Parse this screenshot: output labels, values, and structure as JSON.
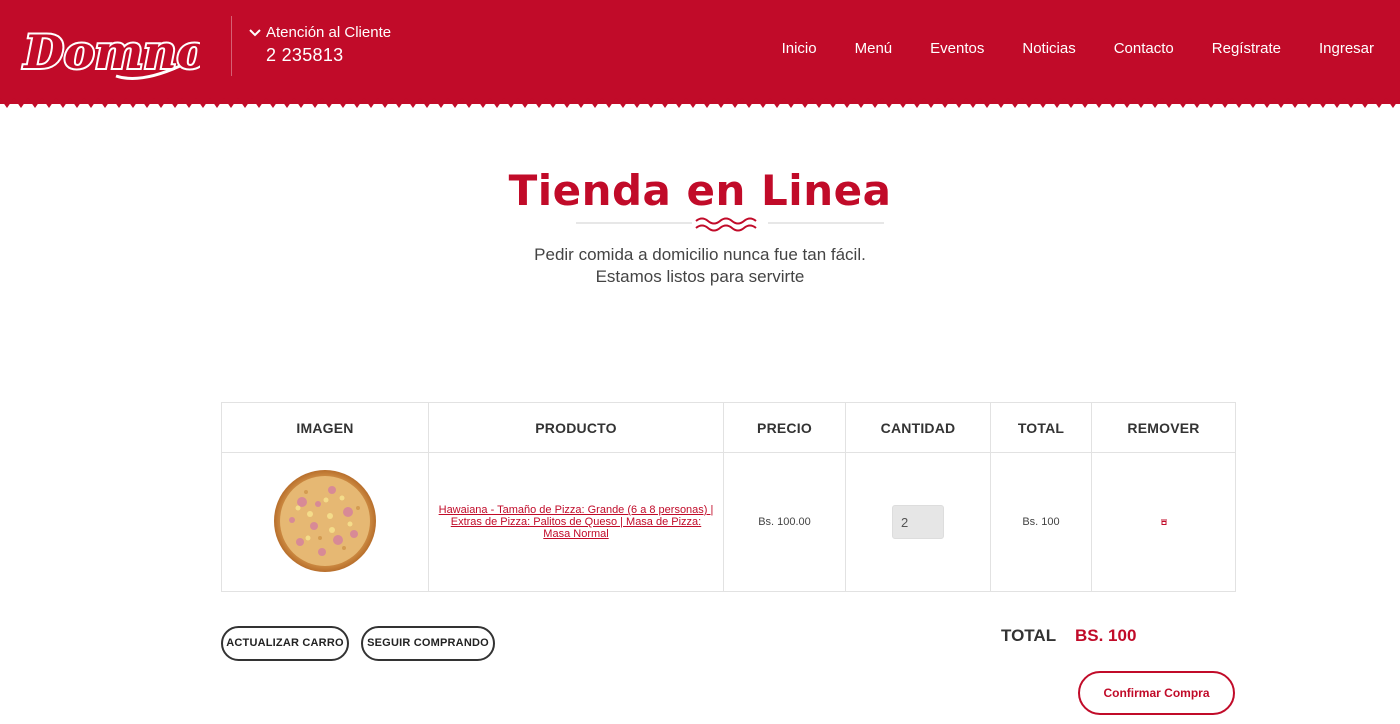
{
  "header": {
    "logo_text": "Domnoo",
    "support_label": "Atención al Cliente",
    "support_phone": "2 235813",
    "nav": [
      "Inicio",
      "Menú",
      "Eventos",
      "Noticias",
      "Contacto",
      "Regístrate",
      "Ingresar"
    ]
  },
  "hero": {
    "title": "Tienda en Linea",
    "subtitle_line1": "Pedir comida a domicilio nunca fue tan fácil.",
    "subtitle_line2": "Estamos listos para servirte"
  },
  "cart": {
    "headers": [
      "IMAGEN",
      "PRODUCTO",
      "PRECIO",
      "CANTIDAD",
      "TOTAL",
      "REMOVER"
    ],
    "rows": [
      {
        "product": "Hawaiana - Tamaño de Pizza: Grande (6 a 8 personas) | Extras de Pizza: Palitos de Queso | Masa de Pizza: Masa Normal",
        "price": "Bs. 100.00",
        "quantity": "2",
        "total": "Bs. 100",
        "remove_icon": "remove-icon"
      }
    ]
  },
  "actions": {
    "update_label": "ACTUALIZAR CARRO",
    "continue_label": "SEGUIR COMPRANDO",
    "total_label": "TOTAL",
    "total_value": "BS. 100",
    "confirm_label": "Confirmar Compra"
  },
  "colors": {
    "brand": "#c10b29",
    "text": "#333333",
    "border": "#e2e2e2"
  }
}
